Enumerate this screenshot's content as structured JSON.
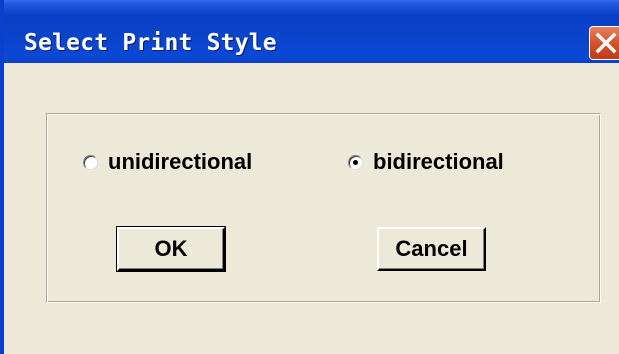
{
  "window": {
    "title": "Select Print Style"
  },
  "options": {
    "unidirectional": {
      "label": "unidirectional",
      "selected": false
    },
    "bidirectional": {
      "label": "bidirectional",
      "selected": true
    }
  },
  "buttons": {
    "ok_label": "OK",
    "cancel_label": "Cancel"
  },
  "colors": {
    "titlebar": "#0843C7",
    "dialog_face": "#ECE9D8",
    "close_button": "#D9552C"
  },
  "icons": {
    "close": "close-icon"
  }
}
